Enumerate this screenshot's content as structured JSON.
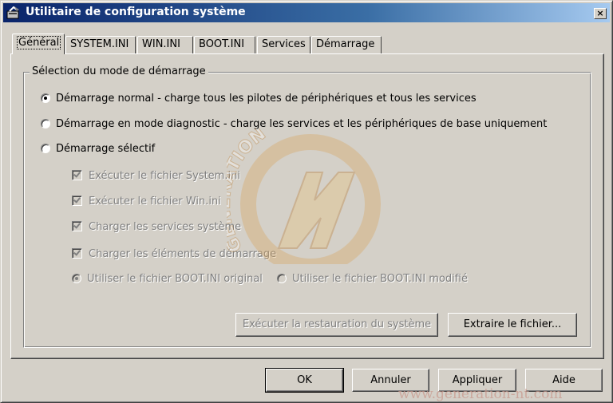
{
  "window": {
    "title": "Utilitaire de configuration système",
    "close_label": "×"
  },
  "tabs": [
    {
      "label": "Général",
      "active": true
    },
    {
      "label": "SYSTEM.INI"
    },
    {
      "label": "WIN.INI"
    },
    {
      "label": "BOOT.INI"
    },
    {
      "label": "Services"
    },
    {
      "label": "Démarrage"
    }
  ],
  "startup_group": {
    "legend": "Sélection du mode de démarrage",
    "options": [
      {
        "label": "Démarrage normal - charge tous les pilotes de périphériques et tous les services",
        "checked": true
      },
      {
        "label": "Démarrage en mode diagnostic - charge les services et les périphériques de base uniquement",
        "checked": false
      },
      {
        "label": "Démarrage sélectif",
        "checked": false
      }
    ],
    "selective_items": [
      {
        "label": "Exécuter le fichier System.ini",
        "checked": true
      },
      {
        "label": "Exécuter le fichier Win.ini",
        "checked": true
      },
      {
        "label": "Charger les services système",
        "checked": true
      },
      {
        "label": "Charger les éléments de démarrage",
        "checked": true
      }
    ],
    "boot_options": [
      {
        "label": "Utiliser le fichier BOOT.INI original",
        "checked": true
      },
      {
        "label": "Utiliser le fichier BOOT.INI modifié",
        "checked": false
      }
    ],
    "restore_button": "Exécuter la restauration du système",
    "extract_button": "Extraire le fichier..."
  },
  "footer": {
    "ok": "OK",
    "cancel": "Annuler",
    "apply": "Appliquer",
    "help": "Aide"
  },
  "watermark": {
    "logo_text": "GENERATION",
    "url": "www.generation-nt.com"
  }
}
